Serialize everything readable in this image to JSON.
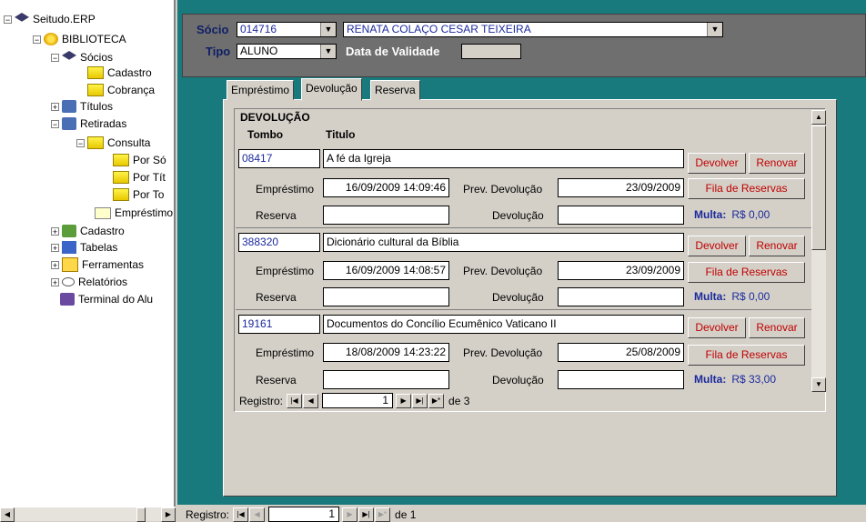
{
  "tree": {
    "root": "Seitudo.ERP",
    "items": [
      {
        "label": "BIBLIOTECA"
      },
      {
        "label": "Sócios"
      },
      {
        "label": "Cadastro"
      },
      {
        "label": "Cobrança"
      },
      {
        "label": "Títulos"
      },
      {
        "label": "Retiradas"
      },
      {
        "label": "Consulta"
      },
      {
        "label": "Por Só"
      },
      {
        "label": "Por Tít"
      },
      {
        "label": "Por To"
      },
      {
        "label": "Empréstimo"
      },
      {
        "label": "Cadastro"
      },
      {
        "label": "Tabelas"
      },
      {
        "label": "Ferramentas"
      },
      {
        "label": "Relatórios"
      },
      {
        "label": "Terminal do Alu"
      }
    ]
  },
  "header": {
    "socio_label": "Sócio",
    "socio_code": "014716",
    "socio_name": "RENATA COLAÇO  CESAR TEIXEIRA",
    "tipo_label": "Tipo",
    "tipo_value": "ALUNO",
    "validade_label": "Data de Validade"
  },
  "tabs": [
    "Empréstimo",
    "Devolução",
    "Reserva"
  ],
  "subform": {
    "title": "DEVOLUÇÃO",
    "col_tombo": "Tombo",
    "col_titulo": "Titulo",
    "label_emprestimo": "Empréstimo",
    "label_prev": "Prev. Devolução",
    "label_reserva": "Reserva",
    "label_devolucao": "Devolução",
    "label_multa": "Multa:",
    "btn_devolver": "Devolver",
    "btn_renovar": "Renovar",
    "btn_fila": "Fila de Reservas",
    "records": [
      {
        "tombo": "08417",
        "titulo": "A fé da Igreja",
        "emprestimo": "16/09/2009 14:09:46",
        "prev": "23/09/2009",
        "reserva": "",
        "devolucao": "",
        "multa": "R$ 0,00"
      },
      {
        "tombo": "388320",
        "titulo": "Dicionário cultural da Bíblia",
        "emprestimo": "16/09/2009 14:08:57",
        "prev": "23/09/2009",
        "reserva": "",
        "devolucao": "",
        "multa": "R$ 0,00"
      },
      {
        "tombo": "19161",
        "titulo": "Documentos do Concílio Ecumênico Vaticano II",
        "emprestimo": "18/08/2009 14:23:22",
        "prev": "25/08/2009",
        "reserva": "",
        "devolucao": "",
        "multa": "R$ 33,00"
      }
    ]
  },
  "inner_nav": {
    "label": "Registro:",
    "position": "1",
    "of": "de 3"
  },
  "outer_nav": {
    "label": "Registro:",
    "position": "1",
    "of": "de 1"
  },
  "colors": {
    "teal": "#197a7e",
    "header_gray": "#6f6f6f",
    "label_blue": "#0f1f66",
    "button_red": "#c00000"
  }
}
